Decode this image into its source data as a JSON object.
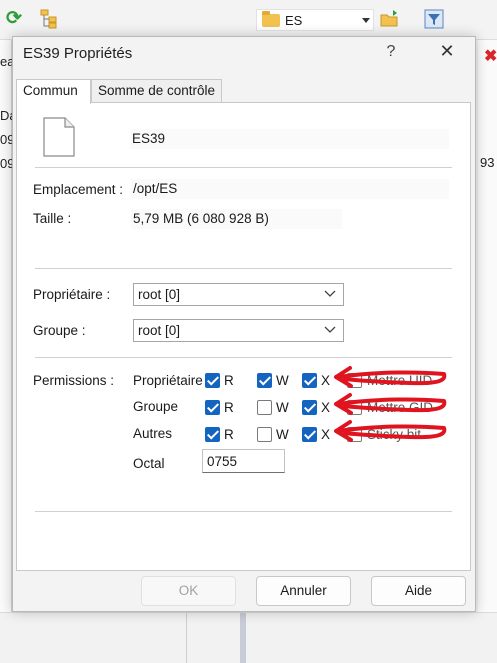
{
  "background": {
    "path_combo": "ES",
    "left_fragments": [
      "ea",
      "Da",
      "09",
      "09"
    ],
    "right_fragment": "93"
  },
  "dialog": {
    "title": "ES39 Propriétés",
    "help_glyph": "?",
    "close_glyph": "✕",
    "tabs": [
      {
        "label": "Commun",
        "selected": true
      },
      {
        "label": "Somme de contrôle",
        "selected": false
      }
    ],
    "file_name": "ES39",
    "location_label": "Emplacement :",
    "location_value": "/opt/ES",
    "size_label": "Taille :",
    "size_value": "5,79 MB (6 080 928 B)",
    "owner_label": "Propriétaire :",
    "owner_value": "root [0]",
    "group_label": "Groupe :",
    "group_value": "root [0]",
    "permissions_label": "Permissions :",
    "permission_rows": [
      {
        "label": "Propriétaire",
        "r": true,
        "w": true,
        "x": true,
        "extra": "Mettre UID"
      },
      {
        "label": "Groupe",
        "r": true,
        "w": false,
        "x": true,
        "extra": "Mettre GID"
      },
      {
        "label": "Autres",
        "r": true,
        "w": false,
        "x": true,
        "extra": "Sticky bit"
      }
    ],
    "perm_letters": {
      "r": "R",
      "w": "W",
      "x": "X"
    },
    "octal_label": "Octal",
    "octal_value": "0755",
    "buttons": {
      "ok": "OK",
      "cancel": "Annuler",
      "help": "Aide"
    }
  },
  "colors": {
    "checkbox_checked": "#1565c0",
    "annotation_arrow": "#e0141e",
    "folder": "#f2c14e"
  }
}
